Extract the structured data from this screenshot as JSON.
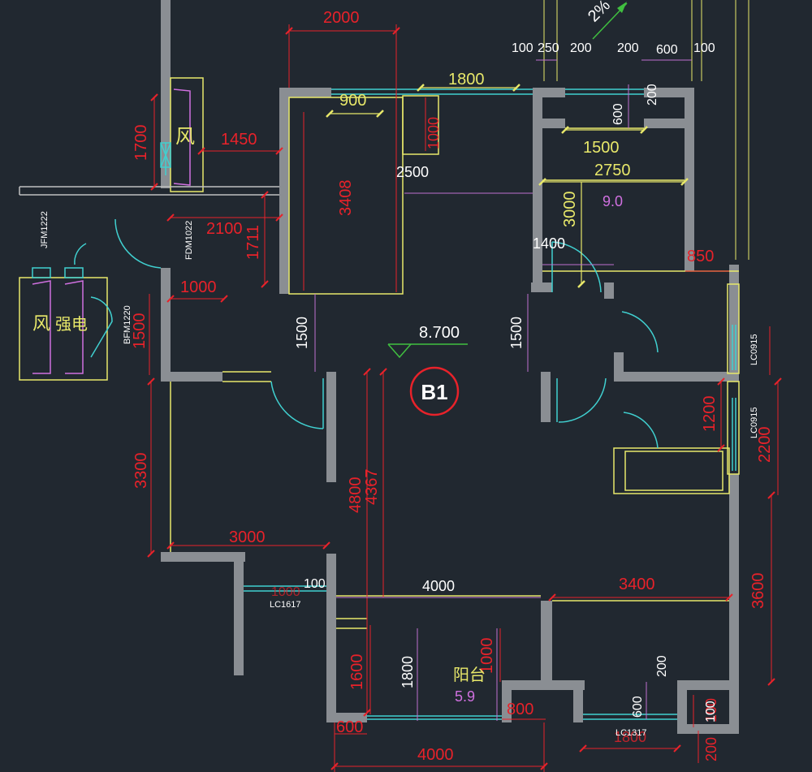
{
  "colors": {
    "background": "#212830",
    "wall": "#8a8e93",
    "dimension": "#e8222a",
    "yellow": "#e8e86a",
    "magenta": "#d070e0",
    "cyan": "#40d0d0",
    "white": "#ffffff",
    "green": "#40c040"
  },
  "dimensions_red": {
    "d2000": "2000",
    "d1700": "1700",
    "d1450": "1450",
    "d3408": "3408",
    "d2100": "2100",
    "d1711": "1711",
    "d1000_left": "1000",
    "d1500_left": "1500",
    "d3300": "3300",
    "d3000": "3000",
    "d4800": "4800",
    "d4367": "4367",
    "d1600_bal": "1600",
    "d600_bottom": "600",
    "d4000_bottom": "4000",
    "d800": "800",
    "d1000_bal": "1000",
    "d3400": "3400",
    "d3600": "3600",
    "d2200": "2200",
    "d1200": "1200",
    "d850": "850",
    "d1800_bottom": "1800",
    "d1000_lc": "1000",
    "d100_bottom": "100",
    "d200_bottom": "200",
    "d1000_closet": "1000"
  },
  "dimensions_yellow": {
    "d900": "900",
    "d1800_top": "1800",
    "d1500_kitchen": "1500",
    "d2750": "2750",
    "d3000_kitchen": "3000"
  },
  "dimensions_white": {
    "d1500_corr_left": "1500",
    "d1500_corr_right": "1500",
    "d2500": "2500",
    "d1400": "1400",
    "d4000_mid": "4000",
    "d1800_bal": "1800",
    "d600_right": "600",
    "d200_right": "200",
    "d100_right": "100",
    "d100_lc": "100",
    "d100_top_a": "100",
    "d250": "250",
    "d200_top_a": "200",
    "d200_top_b": "200",
    "d600_top": "600",
    "d100_top_b": "100",
    "d600_vertical": "600",
    "d200_vertical": "200"
  },
  "labels": {
    "elevation": "8.700",
    "room_area_kitchen": "9.0",
    "room_area_balcony": "5.9",
    "balcony": "阳台",
    "wind_top": "风",
    "wind_left": "风",
    "strong_elec": "强电",
    "slope": "2%",
    "axis_tag": "B1",
    "door_jfm": "JFM1222",
    "door_fdm": "FDM1022",
    "door_bfm": "BFM1220",
    "win_lc1617": "LC1617",
    "win_lc1317": "LC1317",
    "win_lc0915_a": "LC0915",
    "win_lc0915_b": "LC0915"
  }
}
